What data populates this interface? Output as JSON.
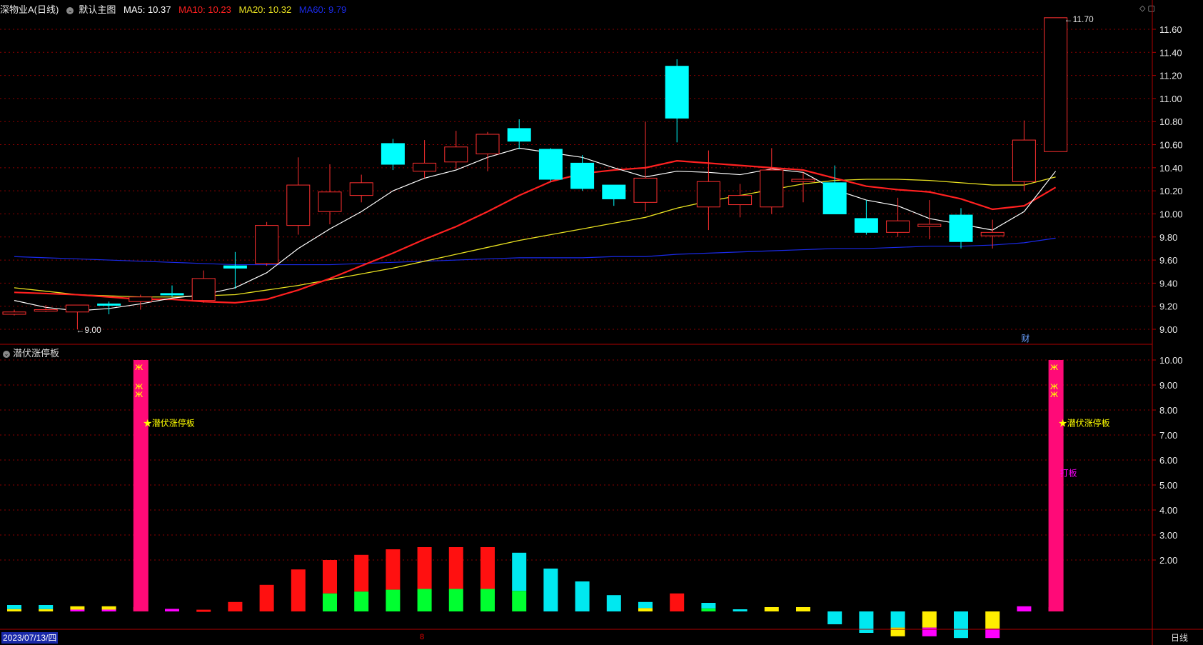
{
  "header": {
    "title": "深物业A(日线)",
    "template": "默认主图",
    "ma5": {
      "label": "MA5: 10.37",
      "color": "#ffffff"
    },
    "ma10": {
      "label": "MA10: 10.23",
      "color": "#ff2020"
    },
    "ma20": {
      "label": "MA20: 10.32",
      "color": "#e8e020"
    },
    "ma60": {
      "label": "MA60: 9.79",
      "color": "#1a2ae8"
    }
  },
  "subpanel": {
    "title": "潜伏涨停板",
    "signal_label": "★潜伏涨停板",
    "signal_label2": "打板"
  },
  "footer": {
    "date": "2023/07/13/四",
    "marker": "8",
    "period": "日线"
  },
  "window_controls": "◇ ▢",
  "annotations": {
    "high": "11.70",
    "low": "9.00",
    "finance_tag": "财"
  },
  "colors": {
    "up": "#ff3030",
    "down": "#00ffff",
    "grid": "#8b0000",
    "axis_text": "#e8e8e8",
    "signal_bar": "#ff0a78",
    "signal_text": "#ffff00",
    "magenta": "#ff00ff"
  },
  "chart_data": [
    {
      "type": "candlestick",
      "title": "深物业A(日线)",
      "ylim": [
        8.95,
        11.75
      ],
      "yticks": [
        "9.00",
        "9.20",
        "9.40",
        "9.60",
        "9.80",
        "10.00",
        "10.20",
        "10.40",
        "10.60",
        "10.80",
        "11.00",
        "11.20",
        "11.40",
        "11.60"
      ],
      "candles": [
        {
          "o": 9.13,
          "h": 9.17,
          "l": 9.12,
          "c": 9.15
        },
        {
          "o": 9.16,
          "h": 9.21,
          "l": 9.15,
          "c": 9.17
        },
        {
          "o": 9.15,
          "h": 9.21,
          "l": 9.0,
          "c": 9.21
        },
        {
          "o": 9.22,
          "h": 9.24,
          "l": 9.13,
          "c": 9.21
        },
        {
          "o": 9.24,
          "h": 9.3,
          "l": 9.17,
          "c": 9.28
        },
        {
          "o": 9.31,
          "h": 9.38,
          "l": 9.28,
          "c": 9.3
        },
        {
          "o": 9.25,
          "h": 9.51,
          "l": 9.23,
          "c": 9.44
        },
        {
          "o": 9.55,
          "h": 9.67,
          "l": 9.35,
          "c": 9.53
        },
        {
          "o": 9.57,
          "h": 9.93,
          "l": 9.55,
          "c": 9.9
        },
        {
          "o": 9.9,
          "h": 10.49,
          "l": 9.82,
          "c": 10.25
        },
        {
          "o": 10.02,
          "h": 10.43,
          "l": 9.91,
          "c": 10.19
        },
        {
          "o": 10.16,
          "h": 10.34,
          "l": 10.1,
          "c": 10.27
        },
        {
          "o": 10.61,
          "h": 10.65,
          "l": 10.38,
          "c": 10.43
        },
        {
          "o": 10.37,
          "h": 10.64,
          "l": 10.31,
          "c": 10.44
        },
        {
          "o": 10.45,
          "h": 10.72,
          "l": 10.39,
          "c": 10.58
        },
        {
          "o": 10.52,
          "h": 10.71,
          "l": 10.37,
          "c": 10.69
        },
        {
          "o": 10.74,
          "h": 10.82,
          "l": 10.56,
          "c": 10.63
        },
        {
          "o": 10.56,
          "h": 10.57,
          "l": 10.28,
          "c": 10.3
        },
        {
          "o": 10.44,
          "h": 10.51,
          "l": 10.2,
          "c": 10.22
        },
        {
          "o": 10.25,
          "h": 10.25,
          "l": 10.07,
          "c": 10.13
        },
        {
          "o": 10.1,
          "h": 10.8,
          "l": 10.02,
          "c": 10.31
        },
        {
          "o": 11.28,
          "h": 11.34,
          "l": 10.62,
          "c": 10.83
        },
        {
          "o": 10.06,
          "h": 10.55,
          "l": 9.86,
          "c": 10.28
        },
        {
          "o": 10.08,
          "h": 10.26,
          "l": 9.97,
          "c": 10.16
        },
        {
          "o": 10.06,
          "h": 10.57,
          "l": 10.0,
          "c": 10.38
        },
        {
          "o": 10.28,
          "h": 10.36,
          "l": 10.1,
          "c": 10.3
        },
        {
          "o": 10.27,
          "h": 10.42,
          "l": 10.0,
          "c": 10.0
        },
        {
          "o": 9.96,
          "h": 10.12,
          "l": 9.82,
          "c": 9.84
        },
        {
          "o": 9.84,
          "h": 10.14,
          "l": 9.8,
          "c": 9.94
        },
        {
          "o": 9.89,
          "h": 10.12,
          "l": 9.78,
          "c": 9.91
        },
        {
          "o": 9.99,
          "h": 10.05,
          "l": 9.7,
          "c": 9.76
        },
        {
          "o": 9.81,
          "h": 9.95,
          "l": 9.7,
          "c": 9.84
        },
        {
          "o": 10.28,
          "h": 10.81,
          "l": 10.2,
          "c": 10.64
        },
        {
          "o": 10.54,
          "h": 11.7,
          "l": 10.54,
          "c": 11.7
        }
      ],
      "ma5": [
        9.25,
        9.19,
        9.16,
        9.18,
        9.22,
        9.27,
        9.3,
        9.36,
        9.49,
        9.7,
        9.87,
        10.02,
        10.2,
        10.31,
        10.38,
        10.49,
        10.57,
        10.53,
        10.49,
        10.4,
        10.32,
        10.37,
        10.36,
        10.34,
        10.39,
        10.36,
        10.21,
        10.12,
        10.07,
        9.96,
        9.91,
        9.86,
        10.02,
        10.37
      ],
      "ma10": [
        9.32,
        9.31,
        9.3,
        9.28,
        9.26,
        9.26,
        9.24,
        9.23,
        9.26,
        9.34,
        9.44,
        9.55,
        9.66,
        9.78,
        9.89,
        10.02,
        10.16,
        10.28,
        10.35,
        10.38,
        10.4,
        10.46,
        10.44,
        10.42,
        10.4,
        10.38,
        10.31,
        10.24,
        10.21,
        10.19,
        10.13,
        10.04,
        10.07,
        10.23
      ],
      "ma20": [
        9.36,
        9.33,
        9.3,
        9.29,
        9.28,
        9.28,
        9.29,
        9.3,
        9.34,
        9.38,
        9.43,
        9.48,
        9.53,
        9.59,
        9.65,
        9.71,
        9.77,
        9.82,
        9.87,
        9.92,
        9.97,
        10.05,
        10.11,
        10.16,
        10.21,
        10.26,
        10.29,
        10.3,
        10.3,
        10.29,
        10.27,
        10.25,
        10.25,
        10.32
      ],
      "ma60": [
        9.63,
        9.62,
        9.61,
        9.6,
        9.59,
        9.58,
        9.57,
        9.56,
        9.56,
        9.56,
        9.56,
        9.57,
        9.58,
        9.59,
        9.6,
        9.61,
        9.62,
        9.62,
        9.62,
        9.63,
        9.63,
        9.65,
        9.66,
        9.67,
        9.68,
        9.69,
        9.7,
        9.7,
        9.71,
        9.72,
        9.72,
        9.73,
        9.75,
        9.79
      ]
    },
    {
      "type": "bar",
      "title": "潜伏涨停板",
      "ylim": [
        0,
        10.4
      ],
      "yticks": [
        "2.00",
        "3.00",
        "4.00",
        "5.00",
        "6.00",
        "7.00",
        "8.00",
        "9.00",
        "10.00"
      ],
      "signal_days": [
        4,
        33
      ],
      "signal_value": 10,
      "bars": [
        {
          "v": 0.15,
          "s": "cy"
        },
        {
          "v": 0.15,
          "s": "cy"
        },
        {
          "v": 0.12,
          "s": "ym"
        },
        {
          "v": 0.12,
          "s": "ym"
        },
        {
          "v": 0.1,
          "s": "ym"
        },
        {
          "v": 0.06,
          "s": "m"
        },
        {
          "v": 0.04,
          "s": "r"
        },
        {
          "v": 0.22,
          "s": "r"
        },
        {
          "v": 0.62,
          "s": "r"
        },
        {
          "v": 0.98,
          "s": "r"
        },
        {
          "v": 1.2,
          "s": "rg"
        },
        {
          "v": 1.32,
          "s": "rg"
        },
        {
          "v": 1.45,
          "s": "rg"
        },
        {
          "v": 1.5,
          "s": "rg"
        },
        {
          "v": 1.5,
          "s": "rg"
        },
        {
          "v": 1.5,
          "s": "rg"
        },
        {
          "v": 1.37,
          "s": "cg"
        },
        {
          "v": 1.0,
          "s": "c"
        },
        {
          "v": 0.7,
          "s": "c"
        },
        {
          "v": 0.38,
          "s": "c"
        },
        {
          "v": 0.22,
          "s": "cy"
        },
        {
          "v": 0.42,
          "s": "r"
        },
        {
          "v": 0.2,
          "s": "cg"
        },
        {
          "v": 0.05,
          "s": "c"
        },
        {
          "v": 0.1,
          "s": "y"
        },
        {
          "v": 0.1,
          "s": "y"
        },
        {
          "v": -0.3,
          "s": "c"
        },
        {
          "v": -0.5,
          "s": "c"
        },
        {
          "v": -0.58,
          "s": "cy"
        },
        {
          "v": -0.58,
          "s": "ym"
        },
        {
          "v": -0.62,
          "s": "c"
        },
        {
          "v": -0.62,
          "s": "ym"
        },
        {
          "v": 0.12,
          "s": "m"
        },
        {
          "v": 0.1,
          "s": "m"
        }
      ]
    }
  ]
}
